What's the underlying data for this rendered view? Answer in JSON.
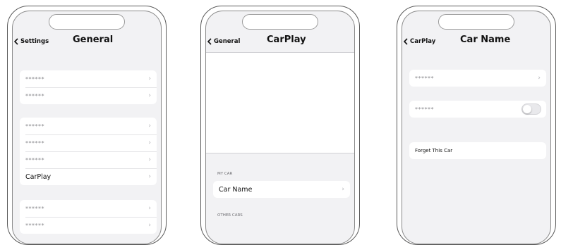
{
  "phones": [
    {
      "back_label": "Settings",
      "title": "General",
      "group1": [
        "******",
        "******"
      ],
      "group2": [
        "******",
        "******",
        "******",
        "CarPlay"
      ],
      "group3": [
        "******",
        "******"
      ]
    },
    {
      "back_label": "General",
      "title": "CarPlay",
      "my_car_header": "MY CAR",
      "car_name_row": "Car Name",
      "other_cars_header": "OTHER CARS"
    },
    {
      "back_label": "CarPlay",
      "title": "Car Name",
      "row1": "******",
      "toggle_row": "******",
      "toggle_on": false,
      "forget_row": "Forget This Car"
    }
  ],
  "icons": {
    "back": "chevron-left-icon",
    "disclosure": "chevron-right-icon"
  },
  "colors": {
    "screen_bg": "#f2f2f4",
    "cell_bg": "#ffffff",
    "chevron": "#b0b0b4"
  }
}
